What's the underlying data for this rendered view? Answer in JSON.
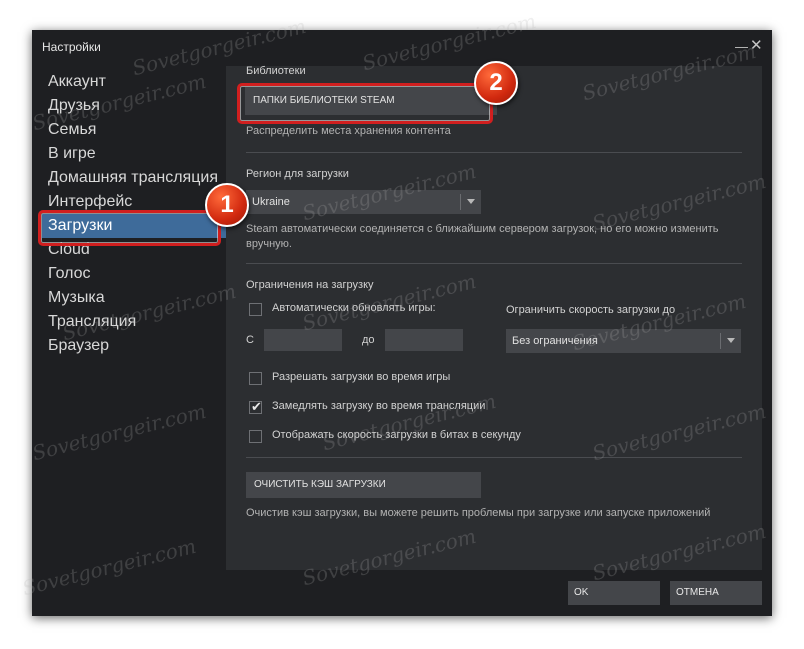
{
  "window": {
    "title": "Настройки"
  },
  "sidebar": {
    "items": [
      {
        "label": "Аккаунт"
      },
      {
        "label": "Друзья"
      },
      {
        "label": "Семья"
      },
      {
        "label": "В игре"
      },
      {
        "label": "Домашняя трансляция"
      },
      {
        "label": "Интерфейс"
      },
      {
        "label": "Загрузки",
        "active": true
      },
      {
        "label": "Cloud"
      },
      {
        "label": "Голос"
      },
      {
        "label": "Музыка"
      },
      {
        "label": "Трансляция"
      },
      {
        "label": "Браузер"
      }
    ]
  },
  "libraries": {
    "heading": "Библиотеки",
    "button_label": "ПАПКИ БИБЛИОТЕКИ STEAM",
    "hint": "Распределить места хранения контента"
  },
  "region": {
    "heading": "Регион для загрузки",
    "selected": "Ukraine",
    "hint_line1": "Steam автоматически соединяется с ближайшим сервером загрузок, но его можно изменить",
    "hint_line2": "вручную."
  },
  "limits": {
    "heading": "Ограничения на загрузку",
    "auto_update_label": "Автоматически обновлять игры:",
    "auto_update_checked": false,
    "from_label": "С",
    "to_label": "до",
    "from_value": "",
    "to_value": "",
    "speed_limit_label": "Ограничить скорость загрузки до",
    "speed_limit_selected": "Без ограничения",
    "allow_during_game_label": "Разрешать загрузки во время игры",
    "allow_during_game_checked": false,
    "throttle_streaming_label": "Замедлять загрузку во время трансляции",
    "throttle_streaming_checked": true,
    "show_bits_label": "Отображать скорость загрузки в битах в секунду",
    "show_bits_checked": false
  },
  "cache": {
    "button_label": "ОЧИСТИТЬ КЭШ ЗАГРУЗКИ",
    "hint": "Очистив кэш загрузки, вы можете решить проблемы при загрузке или запуске приложений"
  },
  "footer": {
    "ok_label": "OK",
    "cancel_label": "ОТМЕНА"
  },
  "annotations": {
    "marker1": "1",
    "marker2": "2",
    "highlight_color": "#d11f1f"
  },
  "watermark": {
    "text": "Sovetgorgeir.com"
  },
  "colors": {
    "active_nav": "#3e6b9a",
    "window_bg": "#1e1f22",
    "content_bg": "#2c2e31",
    "button_bg": "#44464a"
  }
}
